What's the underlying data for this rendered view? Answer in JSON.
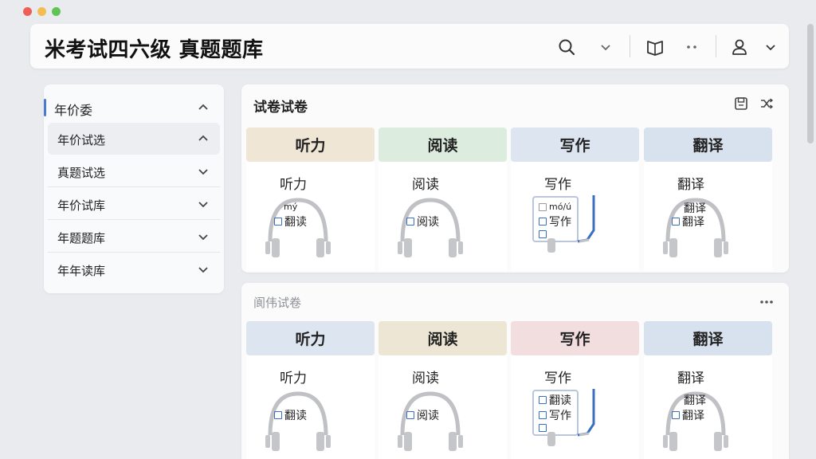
{
  "app": {
    "title": "米考试四六级 真题题库"
  },
  "colors": {
    "accent": "#4a7bd0",
    "listening": "#efe6d6",
    "reading": "#dcede0",
    "writing": "#dde5f1",
    "translation": "#d8e2ef",
    "writing_alt": "#f2dede"
  },
  "header": {
    "icons": [
      "search-icon",
      "chevron-down-icon",
      "book-icon",
      "more-dots-icon",
      "user-icon",
      "chevron-down-icon"
    ]
  },
  "sidebar": {
    "heading": "年价委",
    "items": [
      {
        "label": "年价试选",
        "expanded": true
      },
      {
        "label": "真题试选",
        "expanded": false
      },
      {
        "label": "年价试库",
        "expanded": false
      },
      {
        "label": "年题题库",
        "expanded": false
      },
      {
        "label": "年年读库",
        "expanded": false
      }
    ]
  },
  "panels": [
    {
      "title": "试卷试卷",
      "icons": [
        "save-icon",
        "shuffle-icon"
      ],
      "cards": [
        {
          "label": "听力",
          "sub": "听力",
          "icon": "headphones-icon",
          "options": [
            "mý",
            "翻读"
          ]
        },
        {
          "label": "阅读",
          "sub": "阅读",
          "icon": "headphones-icon",
          "options": [
            "阅读"
          ]
        },
        {
          "label": "写作",
          "sub": "写作",
          "icon": "checklist-pen-icon",
          "options": [
            "mó/ú",
            "写作",
            ""
          ]
        },
        {
          "label": "翻译",
          "sub": "翻译",
          "icon": "headphones-icon",
          "options": [
            "翻译",
            "翻译"
          ]
        }
      ]
    },
    {
      "title": "阆伟试卷",
      "icons": [
        "more-dots-icon"
      ],
      "cards": [
        {
          "label": "听力",
          "sub": "听力",
          "icon": "headphones-icon",
          "options": [
            "翻读"
          ]
        },
        {
          "label": "阅读",
          "sub": "阅读",
          "icon": "headphones-icon",
          "options": [
            "阅读"
          ]
        },
        {
          "label": "写作",
          "sub": "写作",
          "icon": "checklist-pen-icon",
          "options": [
            "翻读",
            "写作",
            ""
          ]
        },
        {
          "label": "翻译",
          "sub": "翻译",
          "icon": "headphones-icon",
          "options": [
            "翻译",
            "翻译"
          ]
        }
      ]
    }
  ]
}
